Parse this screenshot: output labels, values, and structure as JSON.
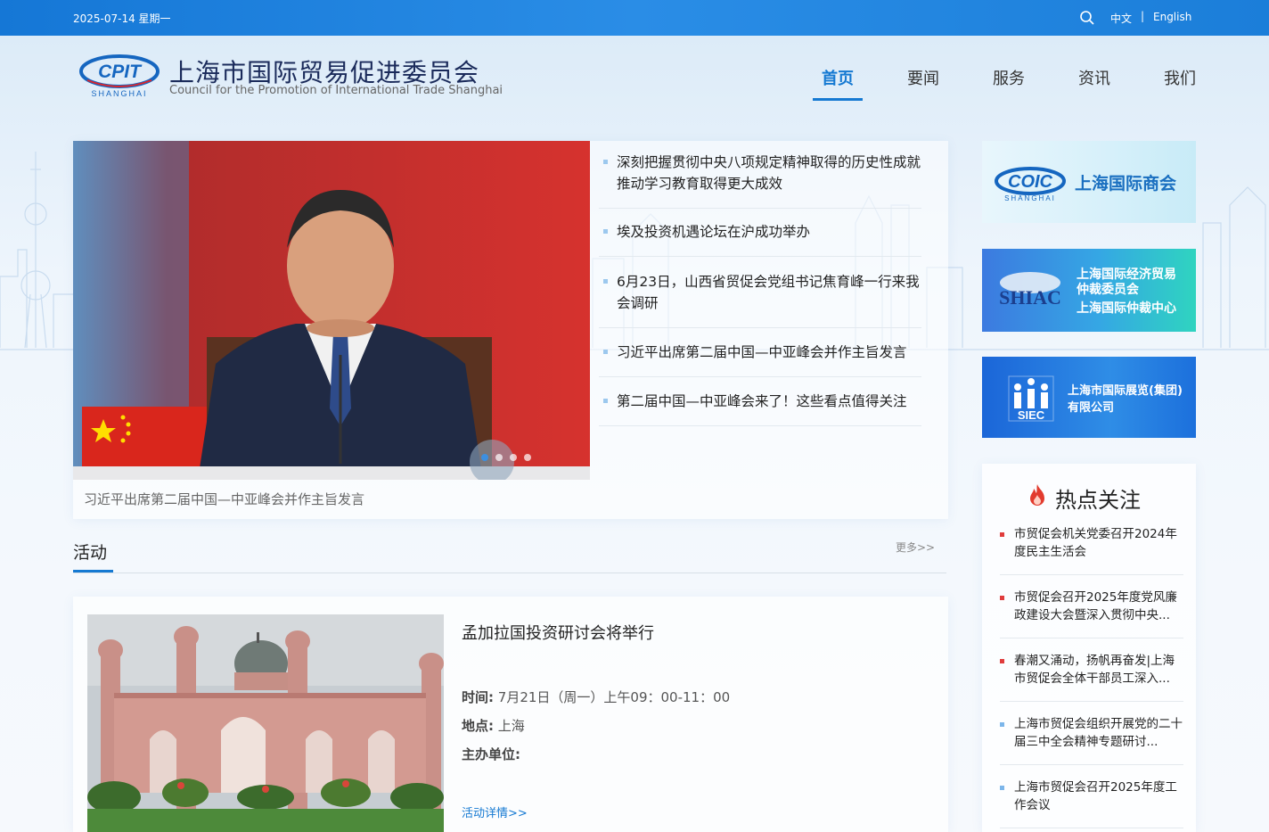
{
  "topbar": {
    "date": "2025-07-14 星期一",
    "lang_zh": "中文",
    "lang_sep": "|",
    "lang_en": "English",
    "search_icon": "search-icon"
  },
  "header": {
    "logo_mark_text": "CPIT",
    "logo_mark_sub": "SHANGHAI",
    "title_cn": "上海市国际贸易促进委员会",
    "title_en": "Council for the Promotion of International Trade Shanghai",
    "nav": [
      "首页",
      "要闻",
      "服务",
      "资讯",
      "我们"
    ],
    "active_nav": "首页"
  },
  "slider": {
    "caption": "习近平出席第二届中国—中亚峰会并作主旨发言",
    "slide_count": 4,
    "active_index": 0
  },
  "news": [
    "深刻把握贯彻中央八项规定精神取得的历史性成就 推动学习教育取得更大成效",
    "埃及投资机遇论坛在沪成功举办",
    "6月23日，山西省贸促会党组书记焦育峰一行来我会调研",
    "习近平出席第二届中国—中亚峰会并作主旨发言",
    "第二届中国—中亚峰会来了！这些看点值得关注"
  ],
  "side_banners": [
    {
      "logo": "COIC",
      "logo_sub": "SHANGHAI",
      "text": "上海国际商会",
      "color": "#1a6fc0"
    },
    {
      "logo": "SHIAC",
      "lines": [
        "上海国际经济贸易",
        "仲裁委员会",
        "上海国际仲裁中心"
      ],
      "color": "#ffffff"
    },
    {
      "logo": "SIEC",
      "lines": [
        "上海市国际展览(集团)",
        "有限公司"
      ],
      "color": "#ffffff"
    }
  ],
  "activities": {
    "section_title": "活动",
    "more": "更多>>",
    "title": "孟加拉国投资研讨会将举行",
    "time_label": "时间:",
    "time_value": "7月21日（周一）上午09：00-11：00",
    "place_label": "地点:",
    "place_value": "上海",
    "host_label": "主办单位:",
    "host_value": "",
    "detail": "活动详情>>"
  },
  "hot": {
    "title": "热点关注",
    "icon": "fire-icon",
    "items": [
      {
        "text": "市贸促会机关党委召开2024年度民主生活会",
        "color": "red"
      },
      {
        "text": "市贸促会召开2025年度党风廉政建设大会暨深入贯彻中央...",
        "color": "red"
      },
      {
        "text": "春潮又涌动，扬帆再奋发|上海市贸促会全体干部员工深入...",
        "color": "red"
      },
      {
        "text": "上海市贸促会组织开展党的二十届三中全会精神专题研讨...",
        "color": "blue"
      },
      {
        "text": "上海市贸促会召开2025年度工作会议",
        "color": "blue"
      }
    ]
  }
}
